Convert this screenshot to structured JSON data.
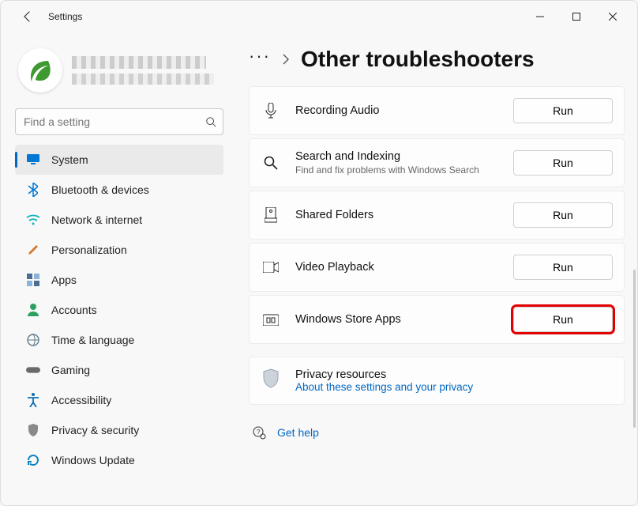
{
  "window": {
    "title": "Settings"
  },
  "search": {
    "placeholder": "Find a setting"
  },
  "nav": {
    "items": [
      {
        "label": "System",
        "icon": "monitor",
        "color": "#0078d4"
      },
      {
        "label": "Bluetooth & devices",
        "icon": "bluetooth",
        "color": "#0078d4"
      },
      {
        "label": "Network & internet",
        "icon": "wifi",
        "color": "#0cb3c2"
      },
      {
        "label": "Personalization",
        "icon": "brush",
        "color": "#d37a2c"
      },
      {
        "label": "Apps",
        "icon": "apps",
        "color": "#4e6c8f"
      },
      {
        "label": "Accounts",
        "icon": "person",
        "color": "#2aa160"
      },
      {
        "label": "Time & language",
        "icon": "globe-clock",
        "color": "#5f7b8c"
      },
      {
        "label": "Gaming",
        "icon": "gamepad",
        "color": "#6a6a6a"
      },
      {
        "label": "Accessibility",
        "icon": "accessibility",
        "color": "#0b6fb3"
      },
      {
        "label": "Privacy & security",
        "icon": "shield",
        "color": "#8a8a8a"
      },
      {
        "label": "Windows Update",
        "icon": "update",
        "color": "#0a84c1"
      }
    ],
    "activeIndex": 0
  },
  "breadcrumb": {
    "ellipsis": "···",
    "title": "Other troubleshooters"
  },
  "troubleshooters": [
    {
      "title": "Recording Audio",
      "sub": "",
      "icon": "mic",
      "run": "Run"
    },
    {
      "title": "Search and Indexing",
      "sub": "Find and fix problems with Windows Search",
      "icon": "search",
      "run": "Run"
    },
    {
      "title": "Shared Folders",
      "sub": "",
      "icon": "shared-folder",
      "run": "Run"
    },
    {
      "title": "Video Playback",
      "sub": "",
      "icon": "video",
      "run": "Run"
    },
    {
      "title": "Windows Store Apps",
      "sub": "",
      "icon": "store",
      "run": "Run",
      "highlight": true
    }
  ],
  "privacy": {
    "title": "Privacy resources",
    "link": "About these settings and your privacy"
  },
  "help": {
    "label": "Get help"
  }
}
